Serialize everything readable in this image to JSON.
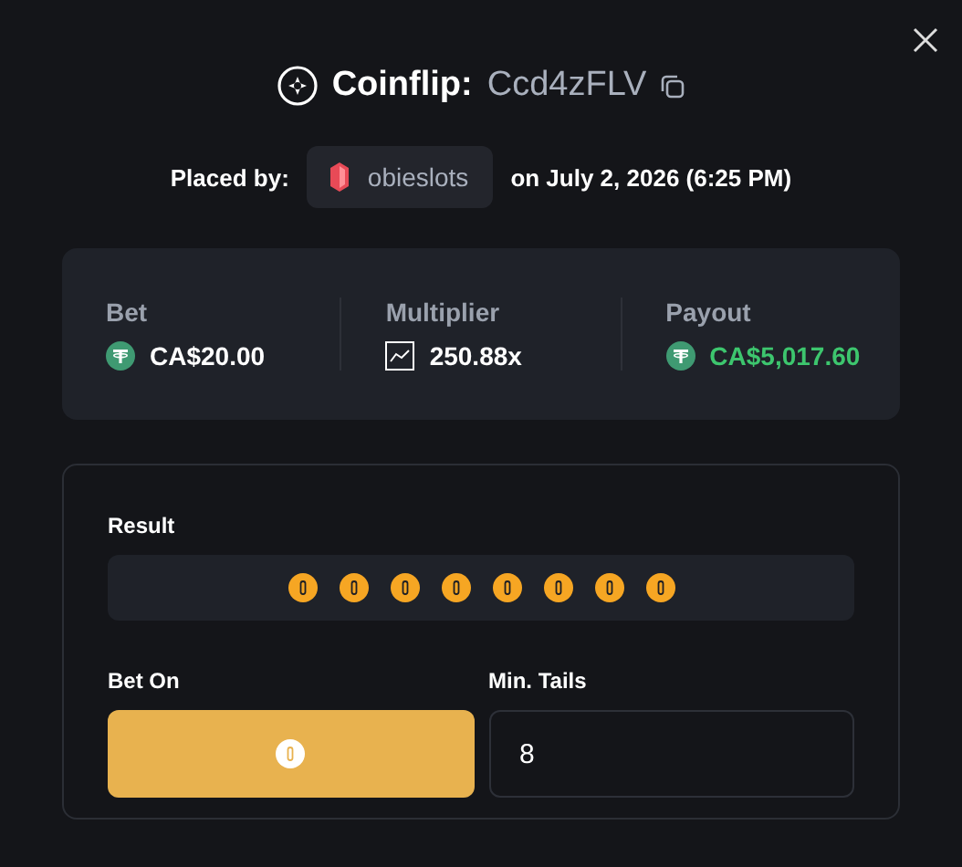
{
  "title": {
    "game": "Coinflip:",
    "id": "Ccd4zFLV"
  },
  "placed": {
    "label": "Placed by:",
    "user": "obieslots",
    "date": "on July 2, 2026 (6:25 PM)"
  },
  "stats": [
    {
      "label": "Bet",
      "value": "CA$20.00",
      "kind": "money",
      "highlight": false
    },
    {
      "label": "Multiplier",
      "value": "250.88x",
      "kind": "multiplier",
      "highlight": false
    },
    {
      "label": "Payout",
      "value": "CA$5,017.60",
      "kind": "money",
      "highlight": true
    }
  ],
  "result": {
    "label": "Result",
    "coins": [
      {
        "kind": "tails"
      },
      {
        "kind": "tails"
      },
      {
        "kind": "tails"
      },
      {
        "kind": "tails"
      },
      {
        "kind": "tails"
      },
      {
        "kind": "tails"
      },
      {
        "kind": "tails"
      },
      {
        "kind": "tails"
      }
    ]
  },
  "bet_on": {
    "label": "Bet On",
    "kind": "tails"
  },
  "min_tails": {
    "label": "Min. Tails",
    "value": "8"
  }
}
